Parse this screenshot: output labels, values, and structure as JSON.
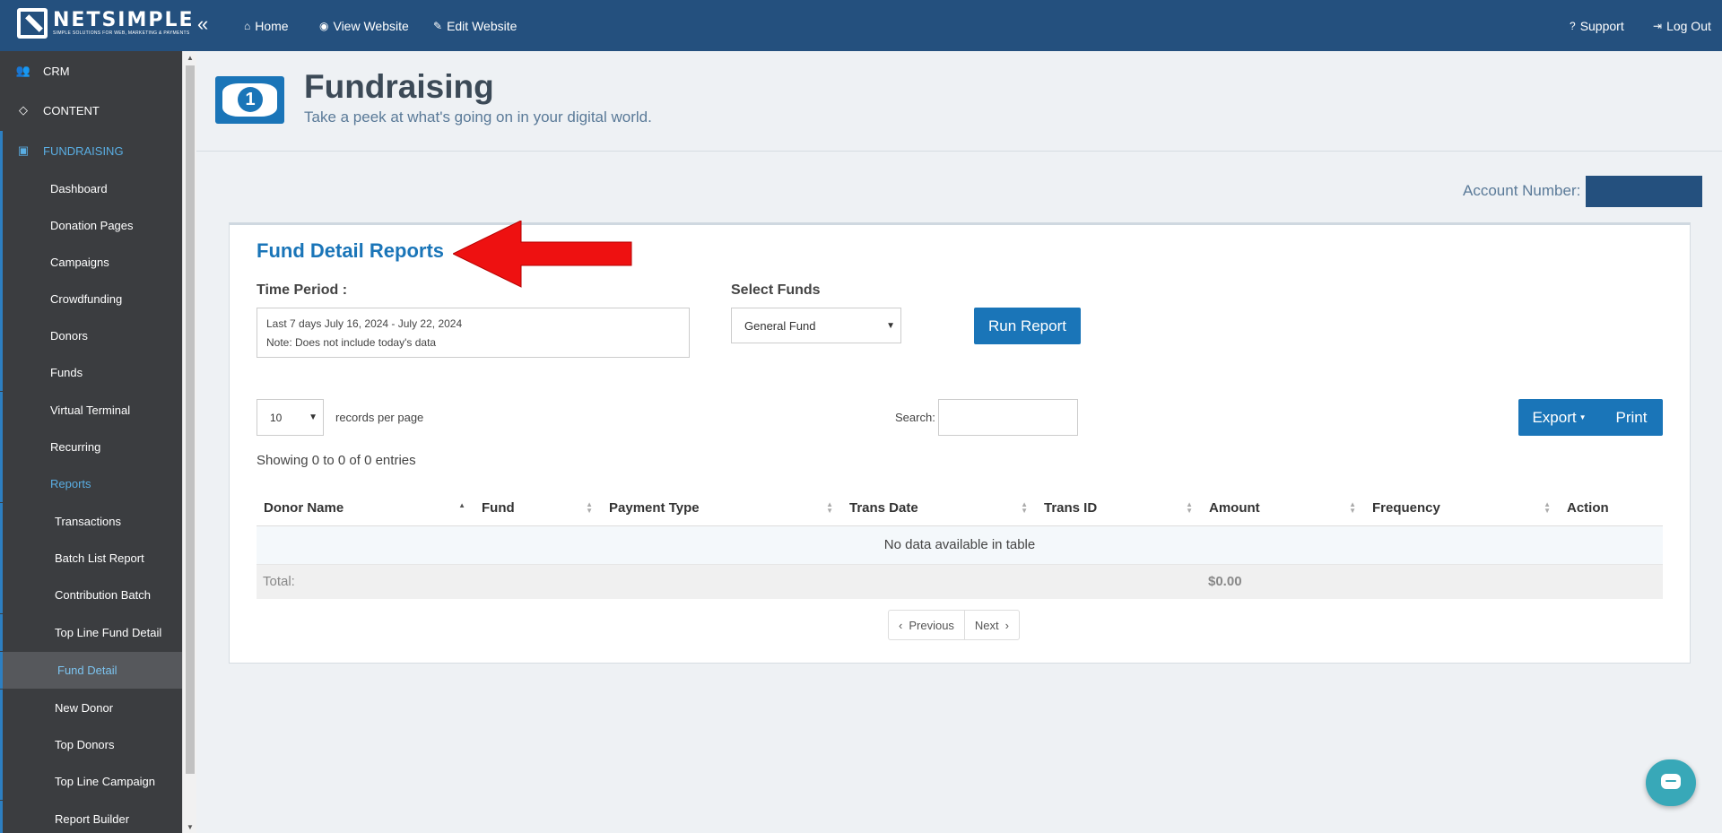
{
  "topbar": {
    "logo": "NETSIMPLE",
    "logo_tagline": "SIMPLE SOLUTIONS FOR WEB, MARKETING & PAYMENTS",
    "nav": [
      {
        "label": "Home",
        "icon": "home-icon"
      },
      {
        "label": "View Website",
        "icon": "eye-icon"
      },
      {
        "label": "Edit Website",
        "icon": "edit-icon"
      }
    ],
    "support": "Support",
    "logout": "Log Out"
  },
  "sidebar": {
    "main": [
      {
        "label": "CRM",
        "icon": "users-icon"
      },
      {
        "label": "CONTENT",
        "icon": "diamond-icon"
      },
      {
        "label": "FUNDRAISING",
        "icon": "money-icon"
      }
    ],
    "sub": [
      "Dashboard",
      "Donation Pages",
      "Campaigns",
      "Crowdfunding",
      "Donors",
      "Funds",
      "Virtual Terminal",
      "Recurring",
      "Reports"
    ],
    "reports": [
      "Transactions",
      "Batch List Report",
      "Contribution Batch",
      "Top Line Fund Detail",
      "Fund Detail",
      "New Donor",
      "Top Donors",
      "Top Line Campaign",
      "Report Builder"
    ]
  },
  "header": {
    "title": "Fundraising",
    "subtitle": "Take a peek at what's going on in your digital world."
  },
  "account_label": "Account Number:",
  "panel": {
    "title": "Fund Detail Reports",
    "time_period_label": "Time Period :",
    "time_period_line1": "Last 7 days July 16, 2024 - July 22, 2024",
    "time_period_line2": "Note: Does not include today's data",
    "select_funds_label": "Select Funds",
    "selected_fund": "General Fund",
    "run_report": "Run Report",
    "records_value": "10",
    "records_label": "records per page",
    "search_label": "Search:",
    "export": "Export",
    "print": "Print",
    "showing": "Showing 0 to 0 of 0 entries",
    "columns": [
      "Donor Name",
      "Fund",
      "Payment Type",
      "Trans Date",
      "Trans ID",
      "Amount",
      "Frequency",
      "Action"
    ],
    "empty_message": "No data available in table",
    "total_label": "Total:",
    "total_amount": "$0.00",
    "previous": "Previous",
    "next": "Next"
  },
  "colors": {
    "brand": "#24507e",
    "accent": "#1a75b8",
    "sidebar": "#3b3d40"
  }
}
